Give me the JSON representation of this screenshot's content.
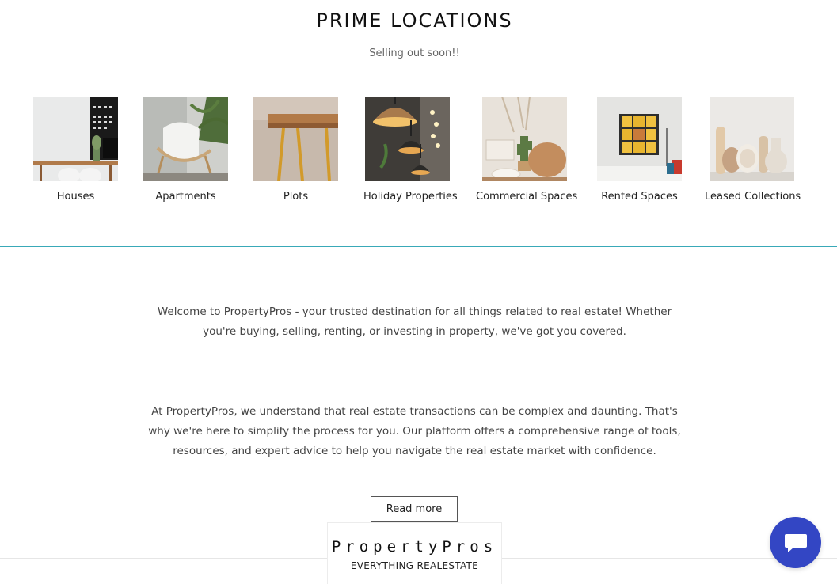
{
  "section": {
    "title": "PRIME LOCATIONS",
    "subtitle": "Selling out soon!!"
  },
  "categories": [
    {
      "label": "Houses",
      "icon": "houses-photo"
    },
    {
      "label": "Apartments",
      "icon": "apartments-photo"
    },
    {
      "label": "Plots",
      "icon": "plots-photo"
    },
    {
      "label": "Holiday Properties",
      "icon": "holiday-properties-photo"
    },
    {
      "label": "Commercial Spaces",
      "icon": "commercial-spaces-photo"
    },
    {
      "label": "Rented Spaces",
      "icon": "rented-spaces-photo"
    },
    {
      "label": "Leased Collections",
      "icon": "leased-collections-photo"
    }
  ],
  "content": {
    "intro": "Welcome to PropertyPros - your trusted destination for all things related to real estate! Whether you're buying, selling, renting, or investing in property, we've got you covered.",
    "about": "At PropertyPros, we understand that real estate transactions can be complex and daunting. That's why we're here to simplify the process for you. Our platform offers a comprehensive range of tools, resources, and expert advice to help you navigate the real estate market with confidence.",
    "read_more_label": "Read more"
  },
  "footer": {
    "brand_name": "PropertyPros",
    "tagline": "EVERYTHING REALESTATE"
  },
  "chat": {
    "icon": "chat-bubble-icon"
  },
  "colors": {
    "accent_line": "#39a9b8",
    "chat_button": "#3346c4"
  }
}
